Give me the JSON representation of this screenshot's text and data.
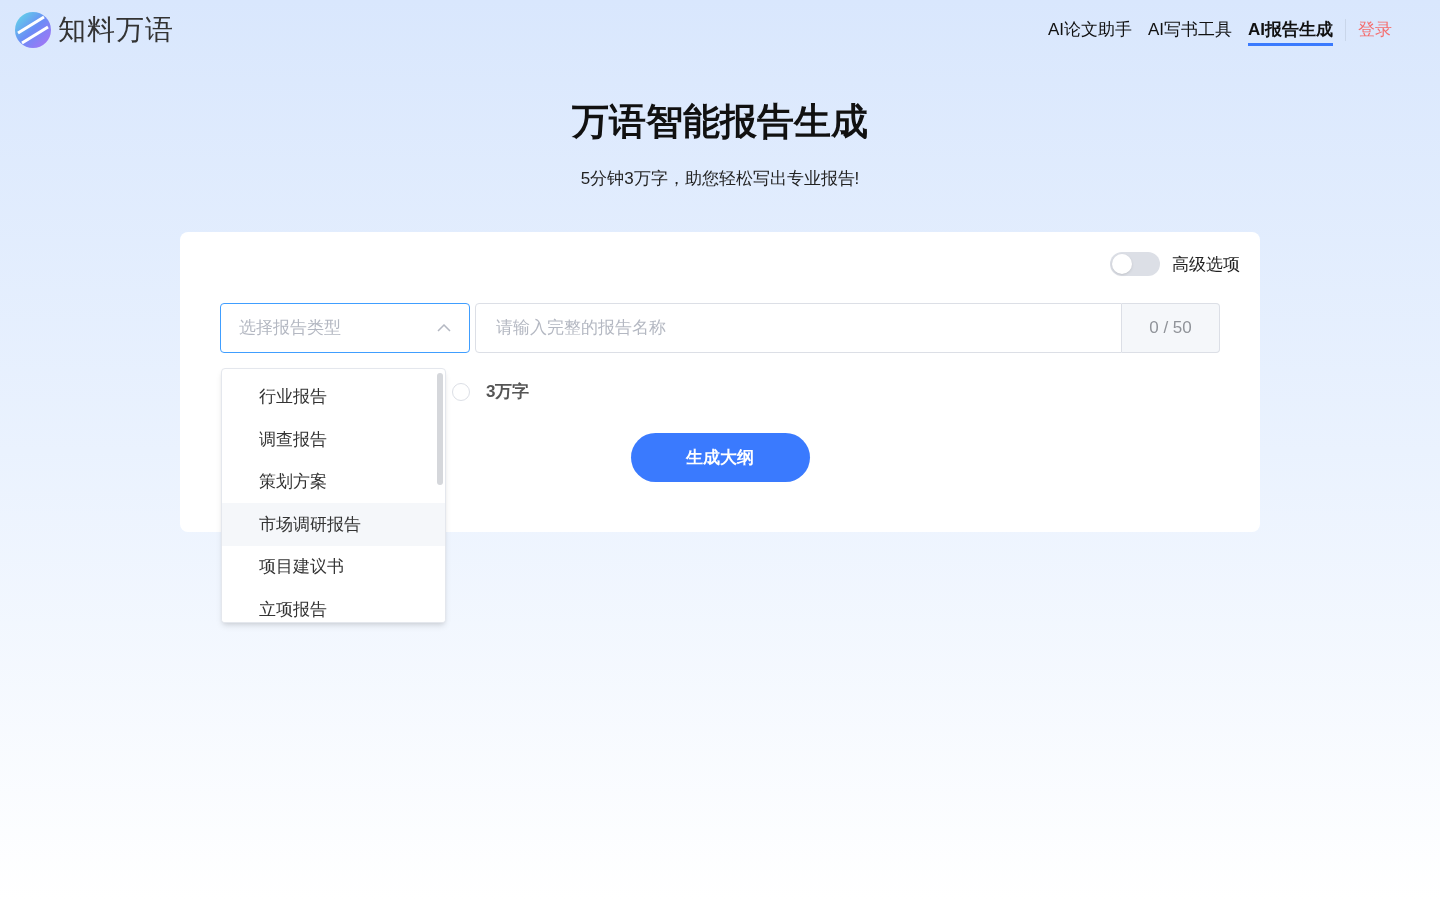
{
  "header": {
    "logo_text": "知料万语",
    "nav": [
      {
        "label": "AI论文助手",
        "selected": false
      },
      {
        "label": "AI写书工具",
        "selected": false
      },
      {
        "label": "AI报告生成",
        "selected": true
      }
    ],
    "login": "登录"
  },
  "hero": {
    "title": "万语智能报告生成",
    "subtitle": "5分钟3万字，助您轻松写出专业报告!"
  },
  "form": {
    "advanced": {
      "label": "高级选项",
      "on": false
    },
    "report_type": {
      "placeholder": "选择报告类型",
      "expanded": true,
      "options": [
        {
          "label": "行业报告",
          "hovered": false
        },
        {
          "label": "调查报告",
          "hovered": false
        },
        {
          "label": "策划方案",
          "hovered": false
        },
        {
          "label": "市场调研报告",
          "hovered": true
        },
        {
          "label": "项目建议书",
          "hovered": false
        },
        {
          "label": "立项报告",
          "hovered": false
        }
      ]
    },
    "report_name": {
      "placeholder": "请输入完整的报告名称",
      "counter": "0 / 50"
    },
    "length_options": [
      {
        "label": "3万字",
        "selected": false
      }
    ],
    "submit": "生成大纲"
  }
}
